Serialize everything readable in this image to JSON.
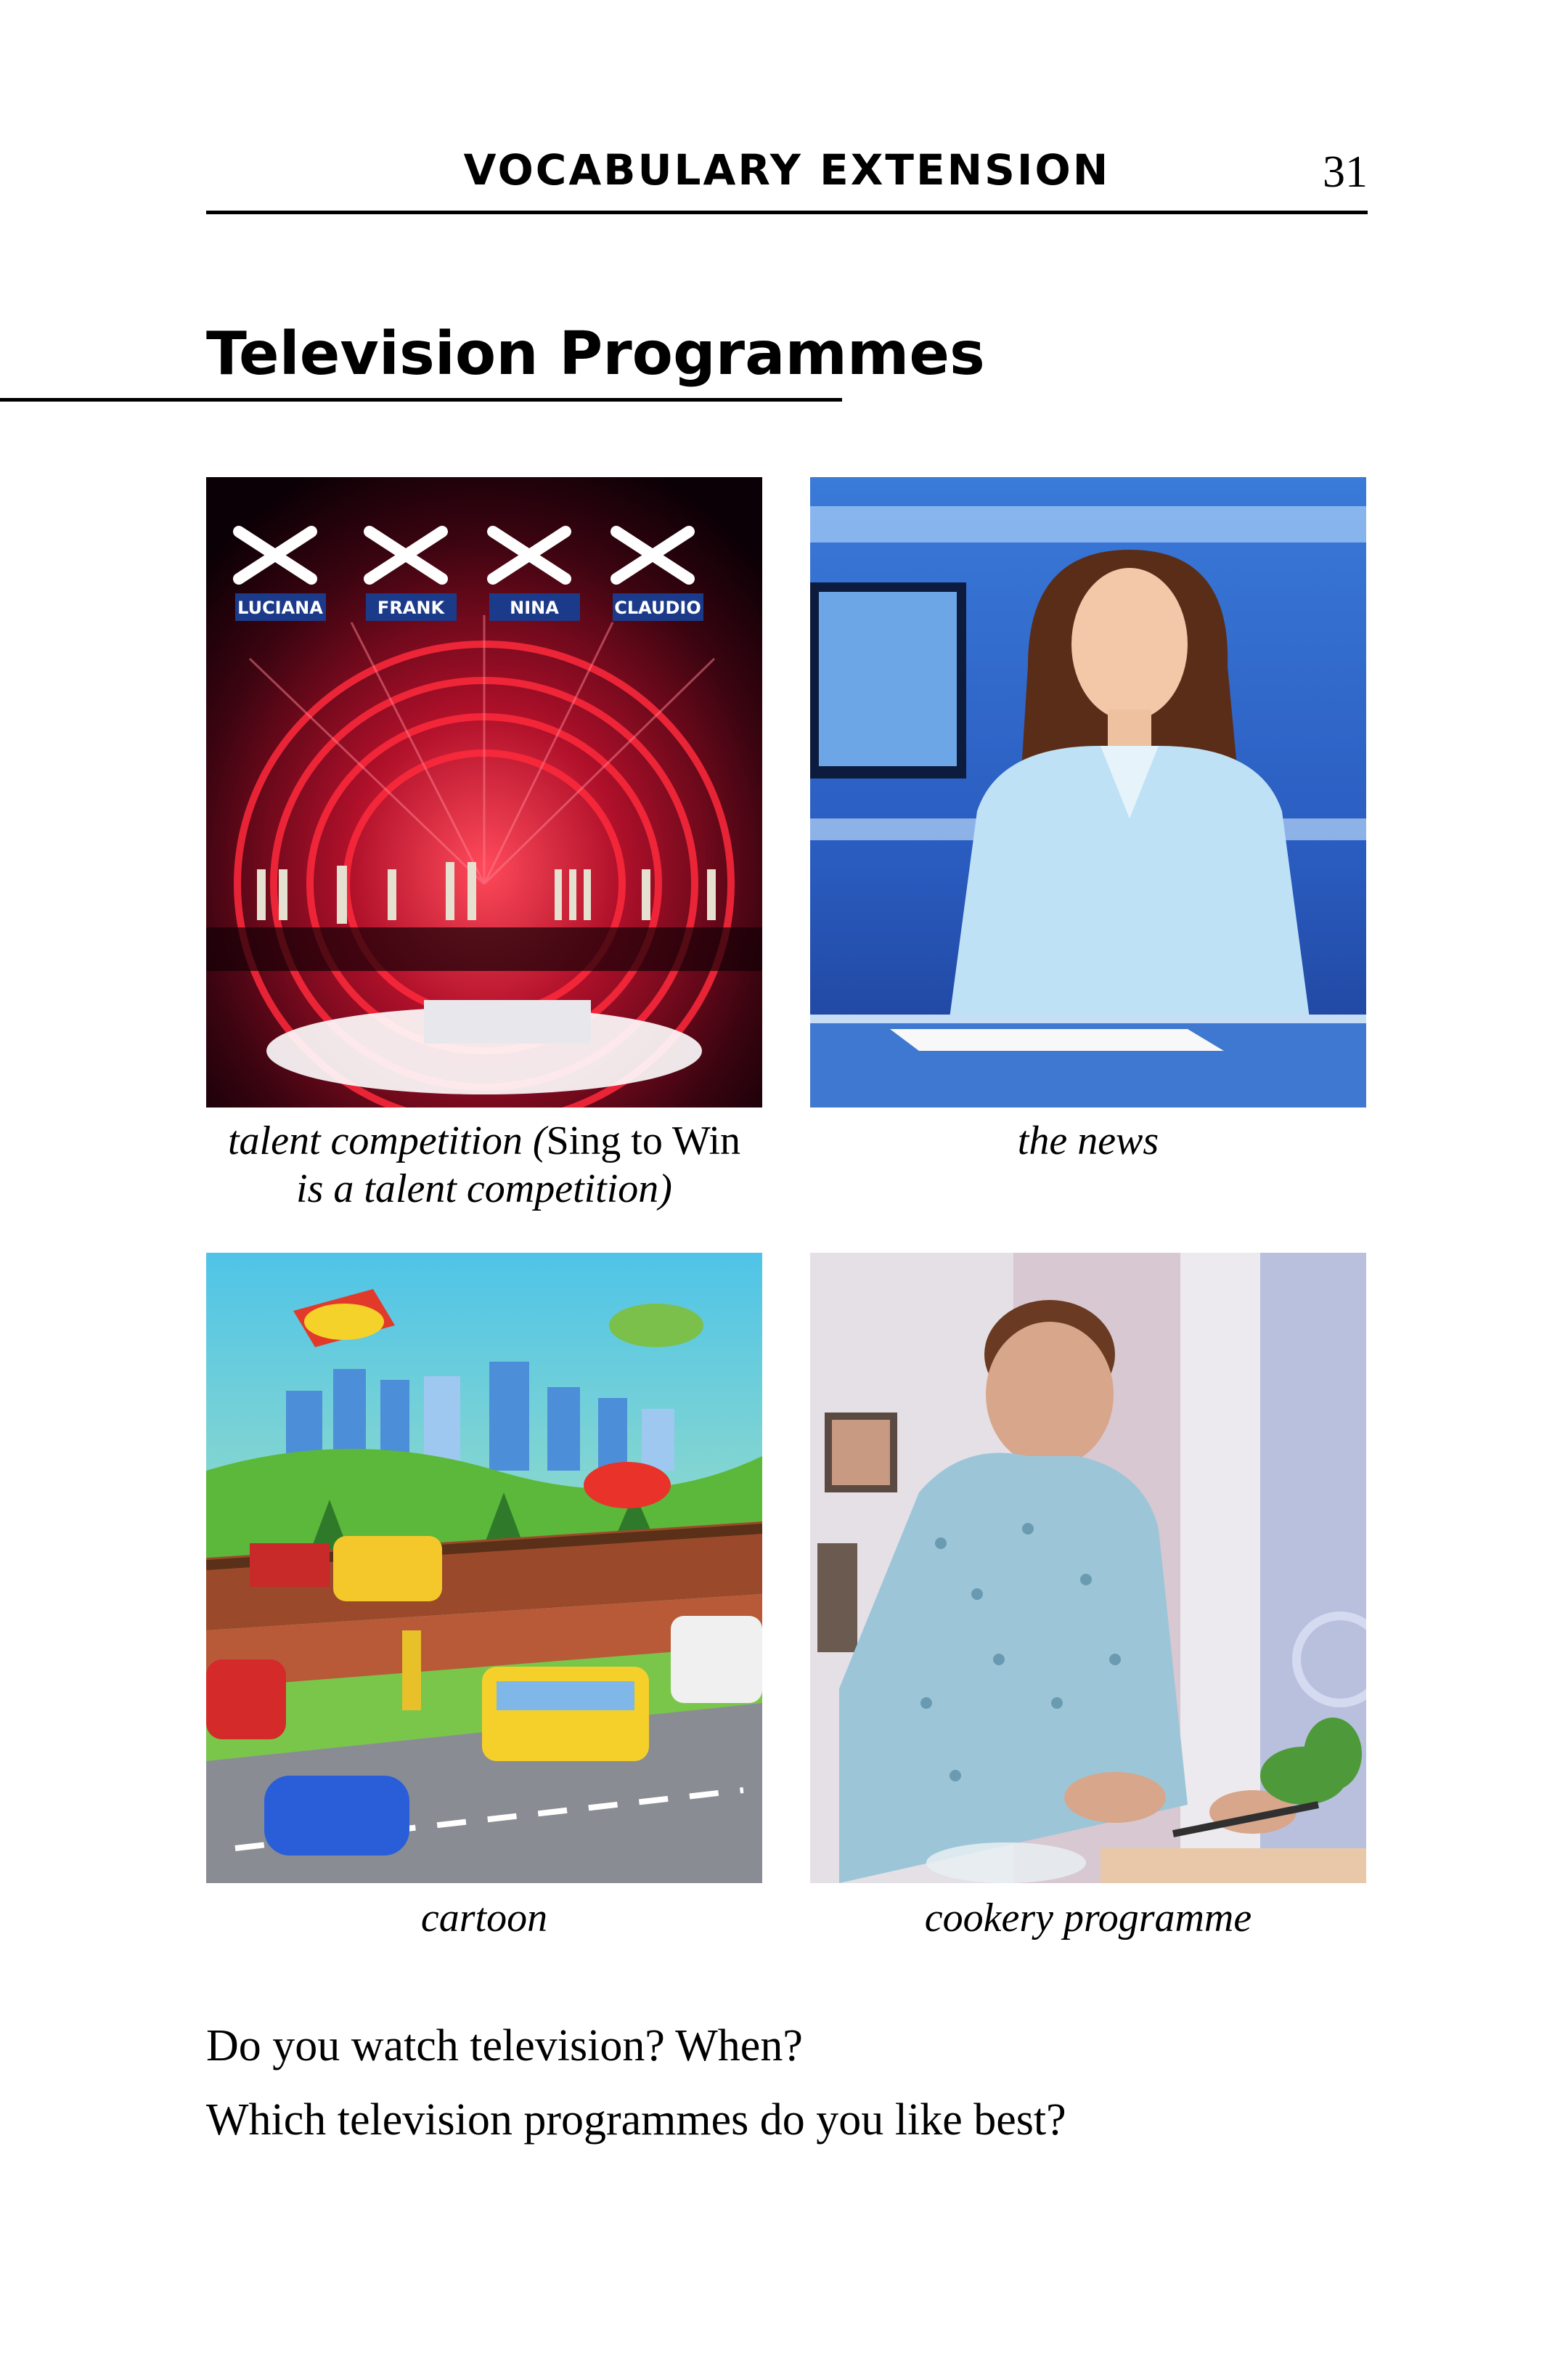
{
  "header": {
    "title": "VOCABULARY EXTENSION",
    "page_number": "31"
  },
  "section": {
    "title": "Television Programmes"
  },
  "photos": {
    "talent": {
      "judge_names": [
        "LUCIANA",
        "FRANK",
        "NINA",
        "CLAUDIO"
      ],
      "caption_italic_1": "talent competition (",
      "caption_upright": "Sing to Win",
      "caption_italic_2": "is a talent competition)"
    },
    "news": {
      "caption": "the news"
    },
    "cartoon": {
      "caption": "cartoon"
    },
    "cookery": {
      "caption": "cookery programme"
    }
  },
  "questions": [
    "Do you watch television? When?",
    "Which television programmes do you like best?"
  ]
}
